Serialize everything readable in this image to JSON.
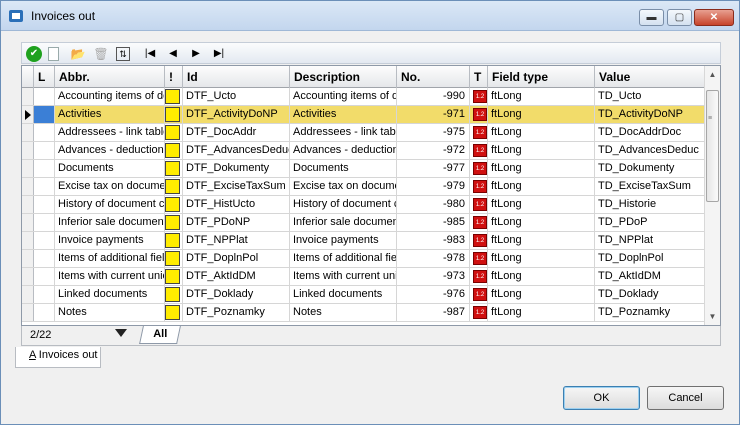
{
  "window": {
    "title": "Invoices out"
  },
  "title_buttons": {
    "minimize": "▬",
    "maximize": "▢",
    "close": "✕"
  },
  "toolbar": {
    "ok_glyph": "✔",
    "new_glyph": "",
    "open_glyph": "📂",
    "delete_glyph": "🗑",
    "refresh_glyph": "⇅",
    "first": "|◀",
    "prev": "◀",
    "next": "▶",
    "last": "▶|"
  },
  "columns": {
    "l": "L",
    "abbr": "Abbr.",
    "excl": "!",
    "id": "Id",
    "description": "Description",
    "no": "No.",
    "t": "T",
    "field_type": "Field type",
    "value": "Value"
  },
  "rows": [
    {
      "abbr": "Accounting items of do",
      "id": "DTF_Ucto",
      "description": "Accounting items of do",
      "no": "-990",
      "t": "1.2",
      "field_type": "ftLong",
      "value": "TD_Ucto"
    },
    {
      "abbr": "Activities",
      "id": "DTF_ActivityDoNP",
      "description": "Activities",
      "no": "-971",
      "t": "1.2",
      "field_type": "ftLong",
      "value": "TD_ActivityDoNP"
    },
    {
      "abbr": "Addressees - link table",
      "id": "DTF_DocAddr",
      "description": "Addressees - link table",
      "no": "-975",
      "t": "1.2",
      "field_type": "ftLong",
      "value": "TD_DocAddrDoc"
    },
    {
      "abbr": "Advances - deduction",
      "id": "DTF_AdvancesDeduc",
      "description": "Advances - deduction",
      "no": "-972",
      "t": "1.2",
      "field_type": "ftLong",
      "value": "TD_AdvancesDeduc"
    },
    {
      "abbr": "Documents",
      "id": "DTF_Dokumenty",
      "description": "Documents",
      "no": "-977",
      "t": "1.2",
      "field_type": "ftLong",
      "value": "TD_Dokumenty"
    },
    {
      "abbr": "Excise tax on docume",
      "id": "DTF_ExciseTaxSum",
      "description": "Excise tax on docume",
      "no": "-979",
      "t": "1.2",
      "field_type": "ftLong",
      "value": "TD_ExciseTaxSum"
    },
    {
      "abbr": "History of document c",
      "id": "DTF_HistUcto",
      "description": "History of document c",
      "no": "-980",
      "t": "1.2",
      "field_type": "ftLong",
      "value": "TD_Historie"
    },
    {
      "abbr": "Inferior sale document",
      "id": "DTF_PDoNP",
      "description": "Inferior sale document",
      "no": "-985",
      "t": "1.2",
      "field_type": "ftLong",
      "value": "TD_PDoP"
    },
    {
      "abbr": "Invoice payments",
      "id": "DTF_NPPlat",
      "description": "Invoice payments",
      "no": "-983",
      "t": "1.2",
      "field_type": "ftLong",
      "value": "TD_NPPlat"
    },
    {
      "abbr": "Items of additional fiel",
      "id": "DTF_DoplnPol",
      "description": "Items of additional fiel",
      "no": "-978",
      "t": "1.2",
      "field_type": "ftLong",
      "value": "TD_DoplnPol"
    },
    {
      "abbr": "Items with current unic",
      "id": "DTF_AktIdDM",
      "description": "Items with current unic",
      "no": "-973",
      "t": "1.2",
      "field_type": "ftLong",
      "value": "TD_AktIdDM"
    },
    {
      "abbr": "Linked documents",
      "id": "DTF_Doklady",
      "description": "Linked documents",
      "no": "-976",
      "t": "1.2",
      "field_type": "ftLong",
      "value": "TD_Doklady"
    },
    {
      "abbr": "Notes",
      "id": "DTF_Poznamky",
      "description": "Notes",
      "no": "-987",
      "t": "1.2",
      "field_type": "ftLong",
      "value": "TD_Poznamky"
    }
  ],
  "selected_row": 1,
  "scrollbar": {
    "up": "▲",
    "down": "▼",
    "grip": "≡"
  },
  "status": {
    "record_count": "2/22",
    "tab_all": "All"
  },
  "page_tab": {
    "accel": "A",
    "label": " Invoices out"
  },
  "buttons": {
    "ok": "OK",
    "cancel": "Cancel"
  }
}
